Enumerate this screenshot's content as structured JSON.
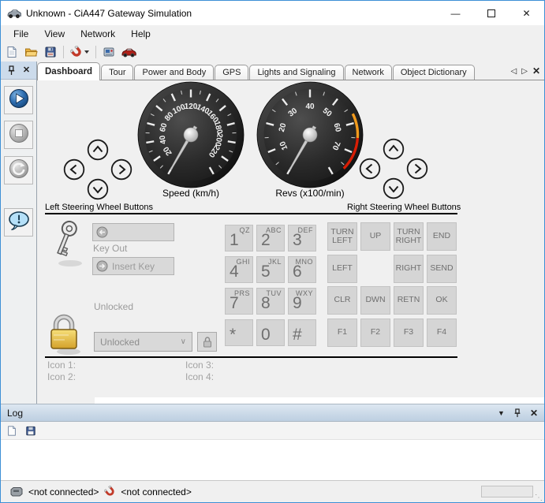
{
  "window": {
    "title": "Unknown - CiA447 Gateway Simulation"
  },
  "icons": {
    "minimize": "—",
    "close": "✕",
    "nav_prev": "◁",
    "nav_next": "▷",
    "dropdown": "▼",
    "combo_chevron": "∨",
    "grip": "⋱"
  },
  "menubar": {
    "items": [
      {
        "label": "File"
      },
      {
        "label": "View"
      },
      {
        "label": "Network"
      },
      {
        "label": "Help"
      }
    ]
  },
  "toolbar": {
    "buttons": [
      {
        "name": "new-file-button",
        "icon": "document-icon"
      },
      {
        "name": "open-file-button",
        "icon": "folder-icon"
      },
      {
        "name": "save-file-button",
        "icon": "floppy-icon"
      },
      {
        "name": "connect-button",
        "icon": "magnet-icon"
      },
      {
        "name": "gateway-button",
        "icon": "device-icon"
      },
      {
        "name": "car-button",
        "icon": "car-icon"
      }
    ]
  },
  "tabs": {
    "items": [
      {
        "label": "Dashboard",
        "active": true
      },
      {
        "label": "Tour",
        "active": false
      },
      {
        "label": "Power and Body",
        "active": false
      },
      {
        "label": "GPS",
        "active": false
      },
      {
        "label": "Lights and Signaling",
        "active": false
      },
      {
        "label": "Network",
        "active": false
      },
      {
        "label": "Object Dictionary",
        "active": false
      }
    ]
  },
  "sidebar": {
    "buttons": [
      {
        "name": "start-simulation-button",
        "icon": "play-icon",
        "enabled": true
      },
      {
        "name": "stop-simulation-button",
        "icon": "stop-icon",
        "enabled": false
      },
      {
        "name": "reset-simulation-button",
        "icon": "reset-icon",
        "enabled": false
      },
      {
        "name": "message-button",
        "icon": "speech-bubble-icon",
        "enabled": true
      }
    ]
  },
  "dashboard": {
    "steering_left": {
      "label": "Left Steering Wheel Buttons"
    },
    "steering_right": {
      "label": "Right Steering Wheel Buttons"
    },
    "key_panel": {
      "key_out_label": "Key Out",
      "insert_key_label": "Insert Key",
      "lock_state_label": "Unlocked",
      "lock_select_value": "Unlocked"
    },
    "keypad": {
      "keys": [
        {
          "digit": "1",
          "letters": "QZ"
        },
        {
          "digit": "2",
          "letters": "ABC"
        },
        {
          "digit": "3",
          "letters": "DEF"
        },
        {
          "digit": "4",
          "letters": "GHI"
        },
        {
          "digit": "5",
          "letters": "JKL"
        },
        {
          "digit": "6",
          "letters": "MNO"
        },
        {
          "digit": "7",
          "letters": "PRS"
        },
        {
          "digit": "8",
          "letters": "TUV"
        },
        {
          "digit": "9",
          "letters": "WXY"
        },
        {
          "digit": "*",
          "letters": ""
        },
        {
          "digit": "0",
          "letters": ""
        },
        {
          "digit": "#",
          "letters": ""
        }
      ]
    },
    "function_pad": {
      "keys": [
        "TURN\nLEFT",
        "UP",
        "TURN\nRIGHT",
        "END",
        "LEFT",
        "",
        "RIGHT",
        "SEND",
        "CLR",
        "DWN",
        "RETN",
        "OK",
        "F1",
        "F2",
        "F3",
        "F4"
      ]
    },
    "icon_labels": [
      "Icon 1:",
      "Icon 2:",
      "Icon 3:",
      "Icon 4:"
    ]
  },
  "log": {
    "title": "Log"
  },
  "status_bar": {
    "items": [
      {
        "icon": "device-icon",
        "label": "<not connected>"
      },
      {
        "icon": "magnet-icon",
        "label": "<not connected>"
      }
    ]
  },
  "chart_data": [
    {
      "type": "gauge",
      "name": "speed-gauge",
      "title": "Speed (km/h)",
      "min": 0,
      "max": 240,
      "start_angle": -150,
      "end_angle": 150,
      "major_step": 20,
      "minor_step": 10,
      "label_min": 20,
      "label_max": 220,
      "label_step": 20,
      "value": 0,
      "bands": []
    },
    {
      "type": "gauge",
      "name": "revs-gauge",
      "title": "Revs (x100/min)",
      "min": 0,
      "max": 80,
      "start_angle": -150,
      "end_angle": 150,
      "major_step": 10,
      "minor_step": 5,
      "label_min": 10,
      "label_max": 70,
      "label_step": 10,
      "value": 0,
      "bands": [
        {
          "from": 57,
          "to": 65,
          "color": "#f29b1d"
        },
        {
          "from": 65,
          "to": 76,
          "color": "#d81e05"
        }
      ]
    }
  ]
}
